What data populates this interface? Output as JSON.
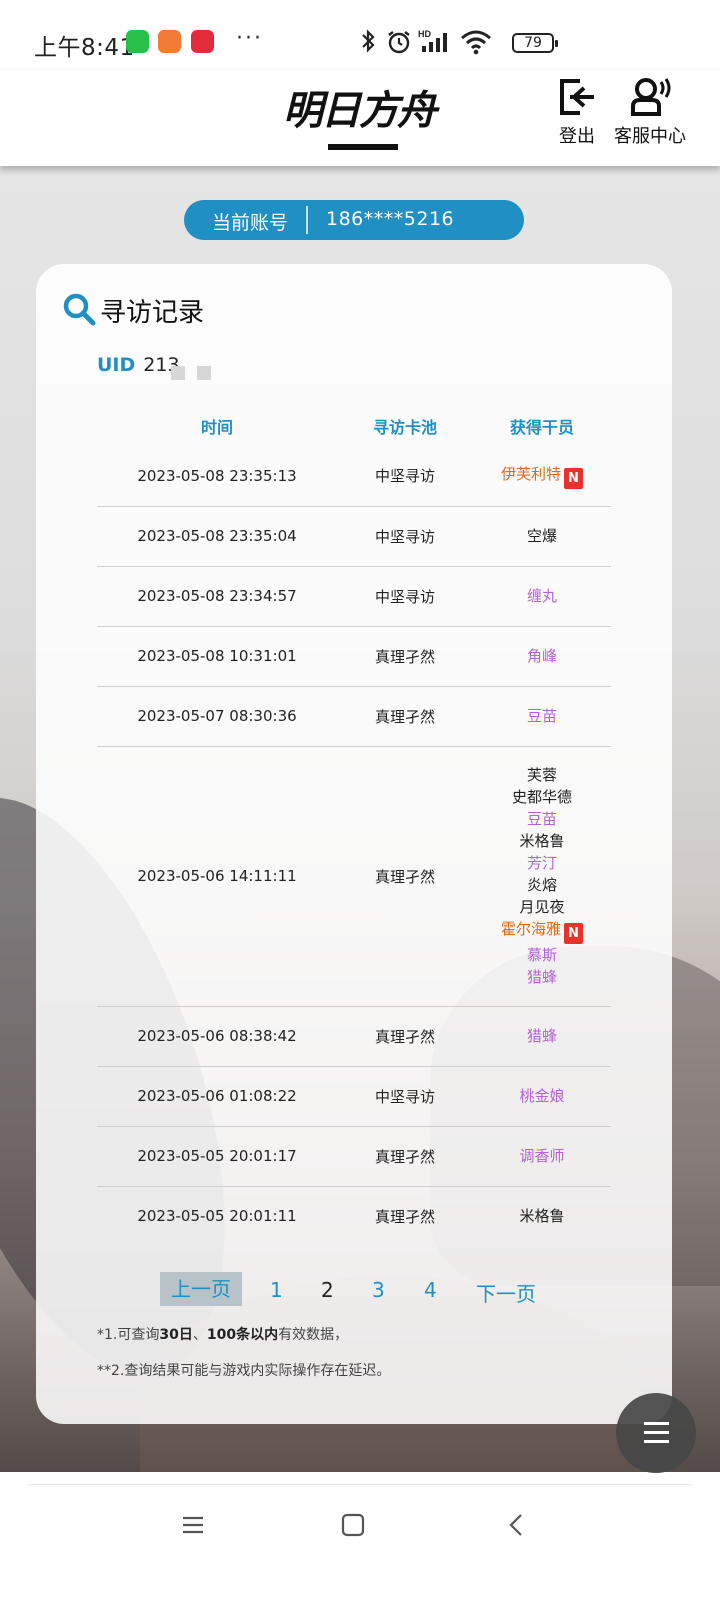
{
  "status_bar": {
    "time": "上午8:41",
    "dots": "···",
    "battery": "79"
  },
  "header": {
    "logo_text": "明日方舟",
    "logout_label": "登出",
    "service_label": "客服中心"
  },
  "account": {
    "label": "当前账号",
    "value": "186****5216"
  },
  "card": {
    "title": "寻访记录",
    "uid_label": "UID",
    "uid_value": "213",
    "columns": [
      "时间",
      "寻访卡池",
      "获得干员"
    ],
    "rows": [
      {
        "time": "2023-05-08 23:35:13",
        "pool": "中坚寻访",
        "ops": [
          {
            "name": "伊芙利特",
            "rarity": 6,
            "new": true
          }
        ]
      },
      {
        "time": "2023-05-08 23:35:04",
        "pool": "中坚寻访",
        "ops": [
          {
            "name": "空爆",
            "rarity": 3
          }
        ]
      },
      {
        "time": "2023-05-08 23:34:57",
        "pool": "中坚寻访",
        "ops": [
          {
            "name": "缠丸",
            "rarity": 4
          }
        ]
      },
      {
        "time": "2023-05-08 10:31:01",
        "pool": "真理孑然",
        "ops": [
          {
            "name": "角峰",
            "rarity": 4
          }
        ]
      },
      {
        "time": "2023-05-07 08:30:36",
        "pool": "真理孑然",
        "ops": [
          {
            "name": "豆苗",
            "rarity": 4
          }
        ]
      },
      {
        "time": "2023-05-06 14:11:11",
        "pool": "真理孑然",
        "ops": [
          {
            "name": "芙蓉",
            "rarity": 3
          },
          {
            "name": "史都华德",
            "rarity": 3
          },
          {
            "name": "豆苗",
            "rarity": 4
          },
          {
            "name": "米格鲁",
            "rarity": 3
          },
          {
            "name": "芳汀",
            "rarity": 4
          },
          {
            "name": "炎熔",
            "rarity": 3
          },
          {
            "name": "月见夜",
            "rarity": 3
          },
          {
            "name": "霍尔海雅",
            "rarity": 6,
            "new": true
          },
          {
            "name": "慕斯",
            "rarity": 4
          },
          {
            "name": "猎蜂",
            "rarity": 4
          }
        ]
      },
      {
        "time": "2023-05-06 08:38:42",
        "pool": "真理孑然",
        "ops": [
          {
            "name": "猎蜂",
            "rarity": 4
          }
        ]
      },
      {
        "time": "2023-05-06 01:08:22",
        "pool": "中坚寻访",
        "ops": [
          {
            "name": "桃金娘",
            "rarity": 4
          }
        ]
      },
      {
        "time": "2023-05-05 20:01:17",
        "pool": "真理孑然",
        "ops": [
          {
            "name": "调香师",
            "rarity": 4
          }
        ]
      },
      {
        "time": "2023-05-05 20:01:11",
        "pool": "真理孑然",
        "ops": [
          {
            "name": "米格鲁",
            "rarity": 3
          }
        ]
      }
    ],
    "new_badge": "N",
    "pagination": {
      "prev_label": "上一页",
      "pages": [
        "1",
        "2",
        "3",
        "4"
      ],
      "current_page": "2",
      "next_label": "下一页"
    },
    "note1_prefix": "*1.可查询",
    "note1_bold1": "30日",
    "note1_mid": "、",
    "note1_bold2": "100条以内",
    "note1_suffix": "有效数据，",
    "note2": "**2.查询结果可能与游戏内实际操作存在延迟。"
  },
  "colors": {
    "accent": "#1f8fc4",
    "rarity6": "#e06b1a",
    "rarity_purple": "#b561d8",
    "new_badge": "#e8322c"
  },
  "icons": {
    "logout": "logout-icon",
    "service": "headset-icon",
    "search": "search-icon",
    "menu": "menu-icon"
  }
}
